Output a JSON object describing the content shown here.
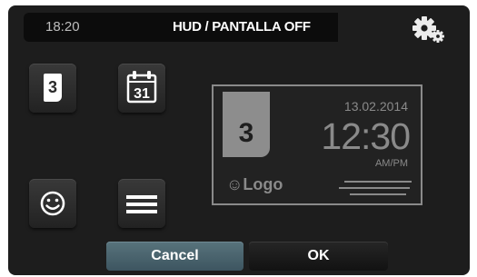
{
  "header": {
    "time": "18:20",
    "title": "HUD / PANTALLA OFF",
    "settings_icon": "gear-icon"
  },
  "options": {
    "day_number": "3",
    "calendar_day": "31",
    "calendar_icon": "calendar-icon",
    "face_icon": "smiley-icon",
    "lines_icon": "menu-lines-icon"
  },
  "preview": {
    "day": "3",
    "date": "13.02.2014",
    "clock": "12:30",
    "ampm": "AM/PM",
    "logo_symbol": "☺",
    "logo_text": "Logo"
  },
  "footer": {
    "cancel_label": "Cancel",
    "ok_label": "OK"
  },
  "colors": {
    "background": "#1d1d1d",
    "topbar": "#0c0c0c",
    "cancel": "#4b6670",
    "preview_text": "#8a8a8a"
  }
}
